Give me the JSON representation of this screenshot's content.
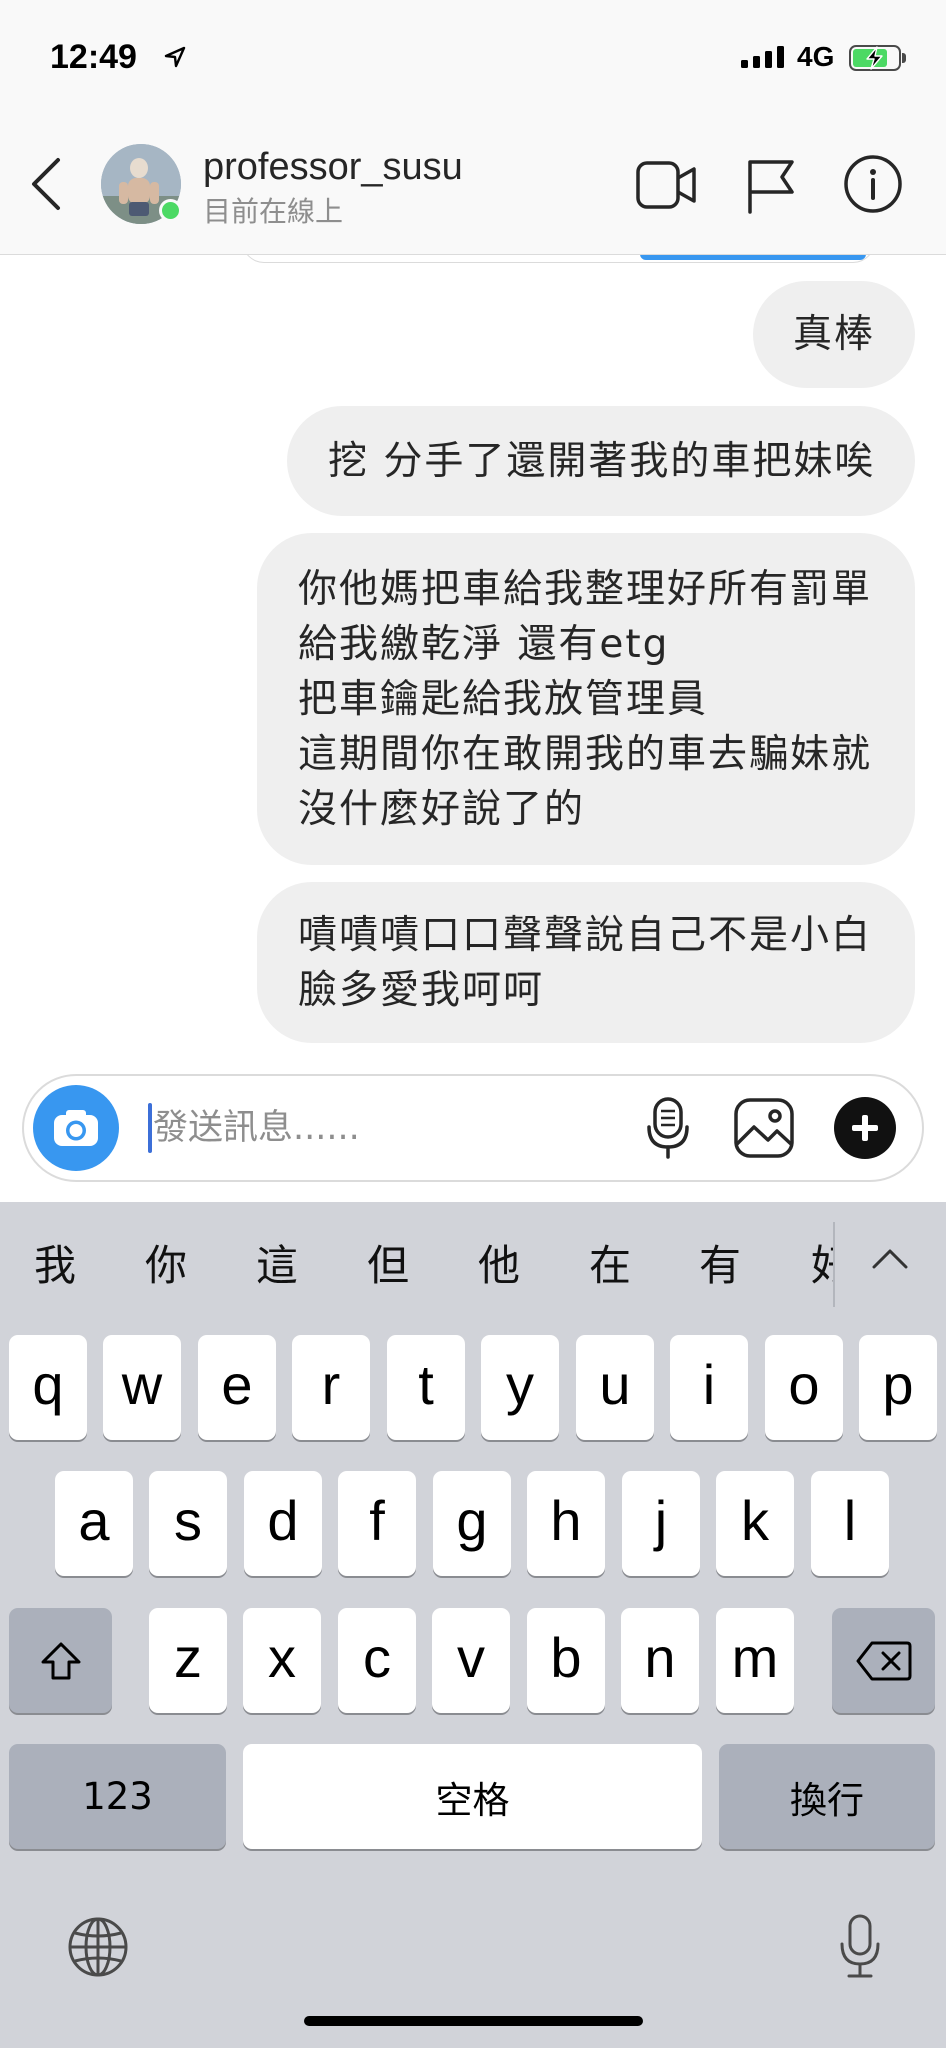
{
  "status_bar": {
    "time": "12:49",
    "network": "4G",
    "battery_fill": 0.7
  },
  "header": {
    "username": "professor_susu",
    "status": "目前在線上"
  },
  "messages": [
    {
      "lines": [
        "真棒"
      ]
    },
    {
      "lines": [
        "挖 分手了還開著我的車把妹唉"
      ]
    },
    {
      "lines": [
        "你他媽把車給我整理好所有罰單",
        "給我繳乾淨 還有etg",
        "把車鑰匙給我放管理員",
        "這期間你在敢開我的車去騙妹就",
        "沒什麼好說了的"
      ]
    },
    {
      "lines": [
        "嘖嘖嘖口口聲聲說自己不是小白",
        "臉多愛我呵呵"
      ]
    }
  ],
  "composer": {
    "placeholder": "發送訊息......"
  },
  "keyboard": {
    "suggestions": [
      "我",
      "你",
      "這",
      "但",
      "他",
      "在",
      "有",
      "好"
    ],
    "row1": [
      "q",
      "w",
      "e",
      "r",
      "t",
      "y",
      "u",
      "i",
      "o",
      "p"
    ],
    "row2": [
      "a",
      "s",
      "d",
      "f",
      "g",
      "h",
      "j",
      "k",
      "l"
    ],
    "row3": [
      "z",
      "x",
      "c",
      "v",
      "b",
      "n",
      "m"
    ],
    "numbers_key": "123",
    "space_key": "空格",
    "return_key": "換行"
  },
  "icons": {
    "header": [
      "back-chevron-icon",
      "video-call-icon",
      "flag-icon",
      "info-icon"
    ],
    "composer": [
      "camera-icon",
      "microphone-icon",
      "image-icon",
      "plus-icon"
    ],
    "keyboard": [
      "shift-icon",
      "delete-icon",
      "globe-icon",
      "dictation-icon",
      "collapse-chevron-icon"
    ]
  },
  "colors": {
    "accent": "#3897f0",
    "bubble": "#efefef",
    "online": "#4cd964",
    "keyboard_bg": "#d1d3d9",
    "key_dark": "#abb0bb"
  }
}
